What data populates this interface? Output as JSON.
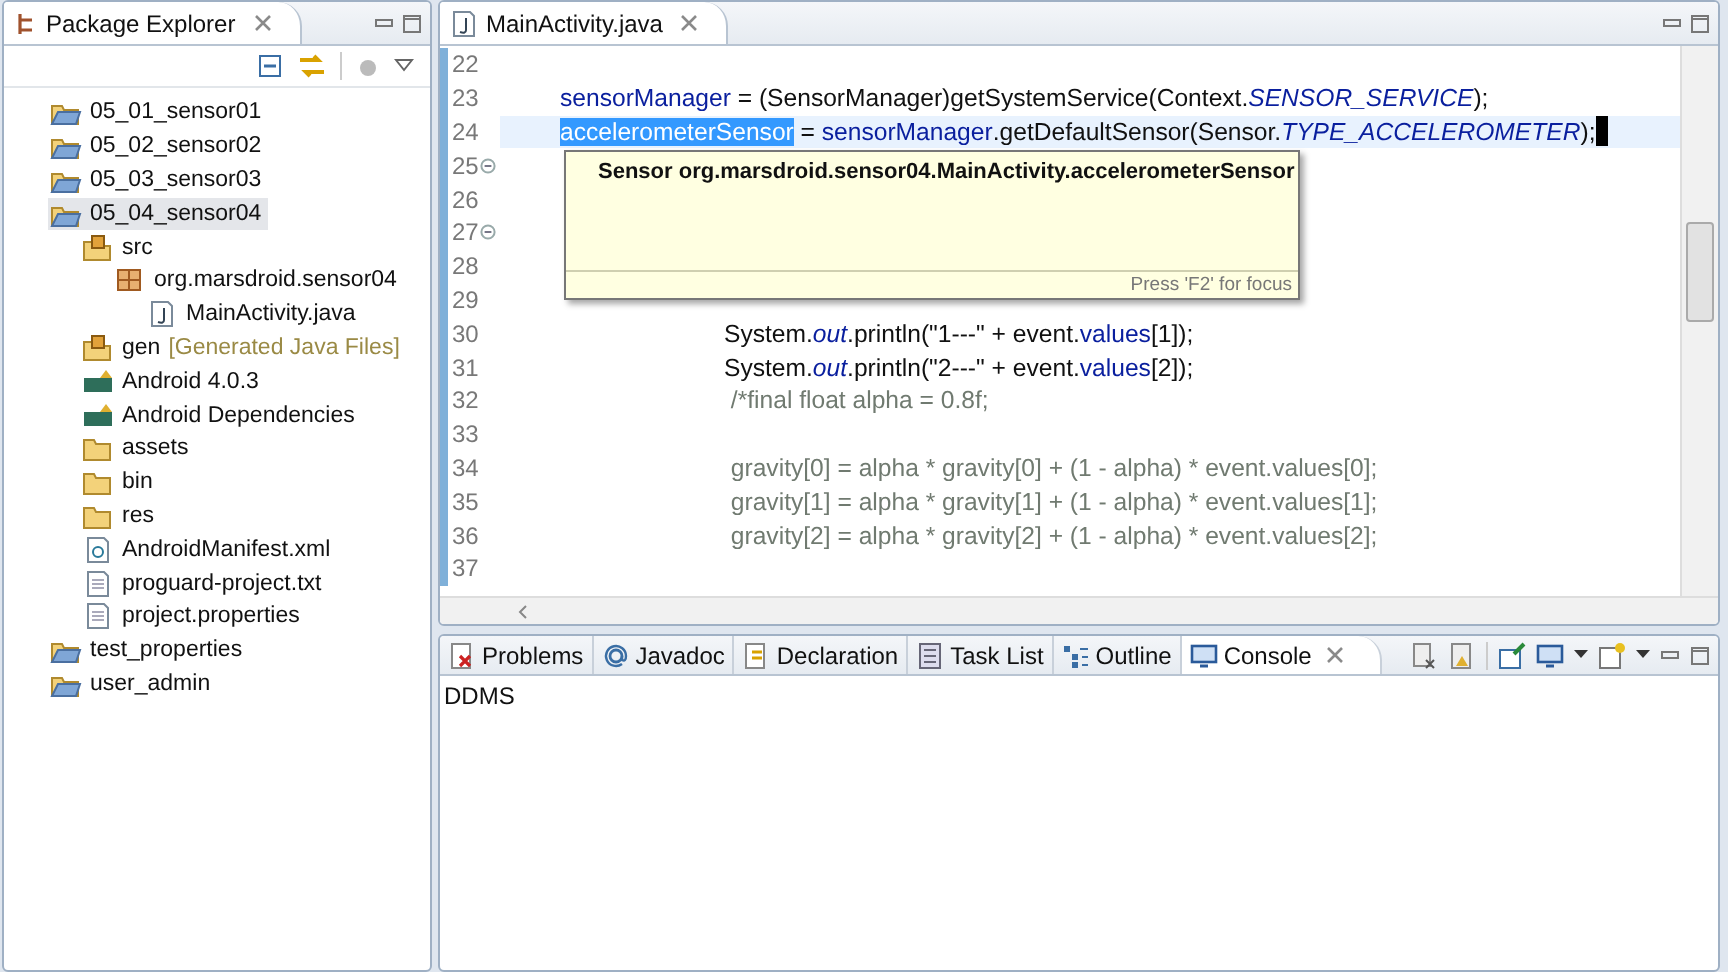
{
  "explorer": {
    "title": "Package Explorer",
    "tree": [
      {
        "label": "05_01_sensor01",
        "kind": "project",
        "selected": false
      },
      {
        "label": "05_02_sensor02",
        "kind": "project",
        "selected": false
      },
      {
        "label": "05_03_sensor03",
        "kind": "project",
        "selected": false
      },
      {
        "label": "05_04_sensor04",
        "kind": "project",
        "selected": true,
        "children": [
          {
            "label": "src",
            "kind": "source",
            "selected": false,
            "children": [
              {
                "label": "org.marsdroid.sensor04",
                "kind": "package",
                "selected": false,
                "children": [
                  {
                    "label": "MainActivity.java",
                    "kind": "java",
                    "selected": false
                  }
                ]
              }
            ]
          },
          {
            "label": "gen",
            "decoration": "[Generated Java Files]",
            "kind": "source",
            "selected": false
          },
          {
            "label": "Android 4.0.3",
            "kind": "library",
            "selected": false
          },
          {
            "label": "Android Dependencies",
            "kind": "library",
            "selected": false
          },
          {
            "label": "assets",
            "kind": "folder",
            "selected": false
          },
          {
            "label": "bin",
            "kind": "folder",
            "selected": false
          },
          {
            "label": "res",
            "kind": "folder",
            "selected": false
          },
          {
            "label": "AndroidManifest.xml",
            "kind": "xml",
            "selected": false
          },
          {
            "label": "proguard-project.txt",
            "kind": "file",
            "selected": false
          },
          {
            "label": "project.properties",
            "kind": "file",
            "selected": false
          }
        ]
      },
      {
        "label": "test_properties",
        "kind": "project",
        "selected": false
      },
      {
        "label": "user_admin",
        "kind": "project",
        "selected": false
      }
    ]
  },
  "editor": {
    "tab": "MainActivity.java",
    "lines": [
      {
        "number": "22",
        "fold": false,
        "current": false
      },
      {
        "number": "23",
        "fold": false,
        "current": false,
        "segments": [
          {
            "kind": "field",
            "text": "sensorManager"
          },
          {
            "kind": "plain",
            "text": " = (SensorManager)getSystemService(Context."
          },
          {
            "kind": "static",
            "text": "SENSOR_SERVICE"
          },
          {
            "kind": "plain",
            "text": ");"
          }
        ]
      },
      {
        "number": "24",
        "fold": false,
        "current": true,
        "segments": [
          {
            "kind": "selection",
            "text": "accelerometerSensor"
          },
          {
            "kind": "plain",
            "text": " = "
          },
          {
            "kind": "field",
            "text": "sensorManager"
          },
          {
            "kind": "plain",
            "text": ".getDefaultSensor(Sensor."
          },
          {
            "kind": "static",
            "text": "TYPE_ACCELEROMETER"
          },
          {
            "kind": "plain",
            "text": ");"
          }
        ]
      },
      {
        "number": "25",
        "fold": true,
        "current": false
      },
      {
        "number": "26",
        "fold": false,
        "current": false
      },
      {
        "number": "27",
        "fold": true,
        "current": false
      },
      {
        "number": "28",
        "fold": false,
        "current": false
      },
      {
        "number": "29",
        "fold": false,
        "current": false
      },
      {
        "number": "30",
        "fold": false,
        "current": false,
        "segments": [
          {
            "kind": "plain",
            "text": "                        System."
          },
          {
            "kind": "static",
            "text": "out"
          },
          {
            "kind": "plain",
            "text": ".println(\"1---\" + event."
          },
          {
            "kind": "field",
            "text": "values"
          },
          {
            "kind": "plain",
            "text": "[1]);"
          }
        ]
      },
      {
        "number": "31",
        "fold": false,
        "current": false,
        "segments": [
          {
            "kind": "plain",
            "text": "                        System."
          },
          {
            "kind": "static",
            "text": "out"
          },
          {
            "kind": "plain",
            "text": ".println(\"2---\" + event."
          },
          {
            "kind": "field",
            "text": "values"
          },
          {
            "kind": "plain",
            "text": "[2]);"
          }
        ]
      },
      {
        "number": "32",
        "fold": false,
        "current": false,
        "segments": [
          {
            "kind": "comment",
            "text": "                         /*final float alpha = 0.8f;"
          }
        ]
      },
      {
        "number": "33",
        "fold": false,
        "current": false
      },
      {
        "number": "34",
        "fold": false,
        "current": false,
        "segments": [
          {
            "kind": "comment",
            "text": "                         gravity[0] = alpha * gravity[0] + (1 - alpha) * event.values[0];"
          }
        ]
      },
      {
        "number": "35",
        "fold": false,
        "current": false,
        "segments": [
          {
            "kind": "comment",
            "text": "                         gravity[1] = alpha * gravity[1] + (1 - alpha) * event.values[1];"
          }
        ]
      },
      {
        "number": "36",
        "fold": false,
        "current": false,
        "segments": [
          {
            "kind": "comment",
            "text": "                         gravity[2] = alpha * gravity[2] + (1 - alpha) * event.values[2];"
          }
        ]
      },
      {
        "number": "37",
        "fold": false,
        "current": false
      }
    ],
    "hover": {
      "signature": "Sensor org.marsdroid.sensor04.MainActivity.accelerometerSensor",
      "hint": "Press 'F2' for focus"
    }
  },
  "bottom_panel": {
    "tabs": [
      {
        "label": "Problems",
        "kind": "problems",
        "selected": false
      },
      {
        "label": "Javadoc",
        "kind": "javadoc",
        "selected": false
      },
      {
        "label": "Declaration",
        "kind": "declaration",
        "selected": false
      },
      {
        "label": "Task List",
        "kind": "tasks",
        "selected": false
      },
      {
        "label": "Outline",
        "kind": "outline",
        "selected": false
      },
      {
        "label": "Console",
        "kind": "console",
        "selected": true
      }
    ],
    "console_name": "DDMS"
  }
}
